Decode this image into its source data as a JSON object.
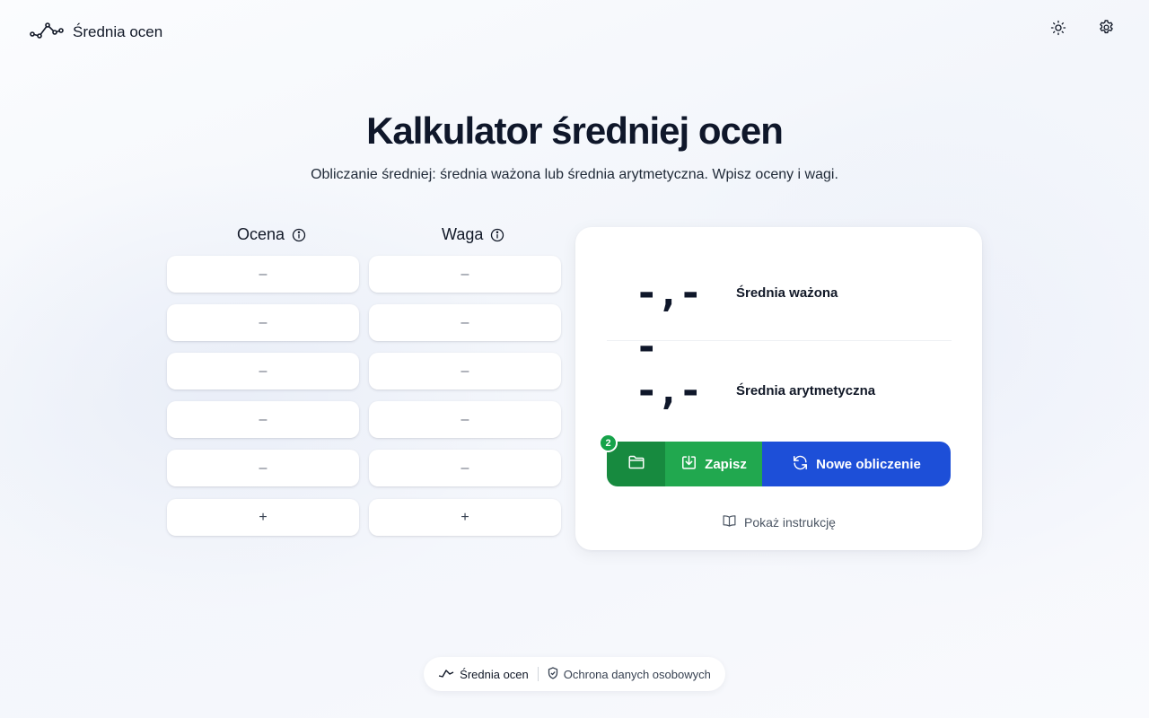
{
  "app": {
    "name": "Średnia ocen"
  },
  "header": {
    "theme_icon": "sun-icon",
    "settings_icon": "gear-icon"
  },
  "page": {
    "title": "Kalkulator średniej ocen",
    "subtitle": "Obliczanie średniej: średnia ważona lub średnia arytmetyczna. Wpisz oceny i wagi."
  },
  "columns": {
    "grade": "Ocena",
    "weight": "Waga"
  },
  "grades": [
    {
      "placeholder": "–"
    },
    {
      "placeholder": "–"
    },
    {
      "placeholder": "–"
    },
    {
      "placeholder": "–"
    },
    {
      "placeholder": "–"
    }
  ],
  "weights": [
    {
      "placeholder": "–"
    },
    {
      "placeholder": "–"
    },
    {
      "placeholder": "–"
    },
    {
      "placeholder": "–"
    },
    {
      "placeholder": "–"
    }
  ],
  "add_label": "+",
  "results": {
    "weighted": {
      "value": "-,--",
      "label": "Średnia ważona"
    },
    "arithmetic": {
      "value": "-,--",
      "label": "Średnia arytmetyczna"
    }
  },
  "actions": {
    "saved_count": "2",
    "save_label": "Zapisz",
    "new_label": "Nowe obliczenie"
  },
  "instructions_label": "Pokaż instrukcję",
  "footer": {
    "home_label": "Średnia ocen",
    "privacy_label": "Ochrona danych osobowych"
  },
  "colors": {
    "folder": "#178a3f",
    "save": "#21a84f",
    "new": "#1d4fd8",
    "badge": "#16a34a"
  }
}
